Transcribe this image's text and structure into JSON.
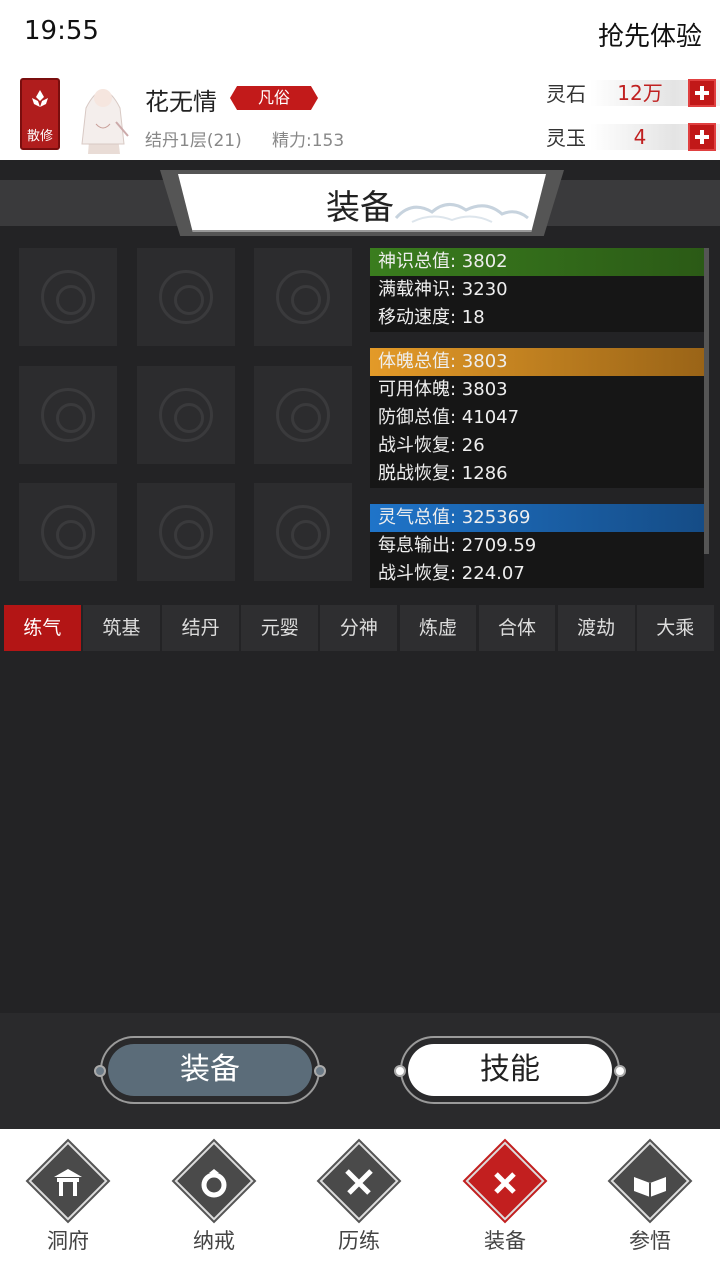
{
  "status_bar": {
    "time": "19:55",
    "early_access": "抢先体验"
  },
  "player": {
    "sect": "散修",
    "name": "花无情",
    "rank_tag": "凡俗",
    "realm": "结丹1层(21)",
    "energy": "精力:153"
  },
  "currency": [
    {
      "label": "灵石",
      "value": "12万"
    },
    {
      "label": "灵玉",
      "value": "4"
    }
  ],
  "page_title": "装备",
  "equipment_slots": 9,
  "stats": {
    "spirit": {
      "total": "神识总值: 3802",
      "rows": [
        "满载神识: 3230",
        "移动速度: 18"
      ]
    },
    "body": {
      "total": "体魄总值: 3803",
      "rows": [
        "可用体魄: 3803",
        "防御总值: 41047",
        "战斗恢复: 26",
        "脱战恢复: 1286"
      ]
    },
    "qi": {
      "total": "灵气总值: 325369",
      "rows": [
        "每息输出: 2709.59",
        "战斗恢复: 224.07"
      ]
    }
  },
  "realm_tabs": [
    "练气",
    "筑基",
    "结丹",
    "元婴",
    "分神",
    "炼虚",
    "合体",
    "渡劫",
    "大乘"
  ],
  "active_tab": "练气",
  "buttons": {
    "equip": "装备",
    "skill": "技能"
  },
  "nav": [
    {
      "label": "洞府",
      "icon": "gate-icon"
    },
    {
      "label": "纳戒",
      "icon": "ring-icon"
    },
    {
      "label": "历练",
      "icon": "crossed-swords-icon"
    },
    {
      "label": "装备",
      "icon": "equip-x-icon"
    },
    {
      "label": "参悟",
      "icon": "book-icon"
    }
  ],
  "active_nav": "装备",
  "colors": {
    "accent_red": "#c21a1a",
    "spirit_green": "#3a7d1e",
    "body_orange": "#e39a28",
    "qi_blue": "#1f74c9"
  }
}
